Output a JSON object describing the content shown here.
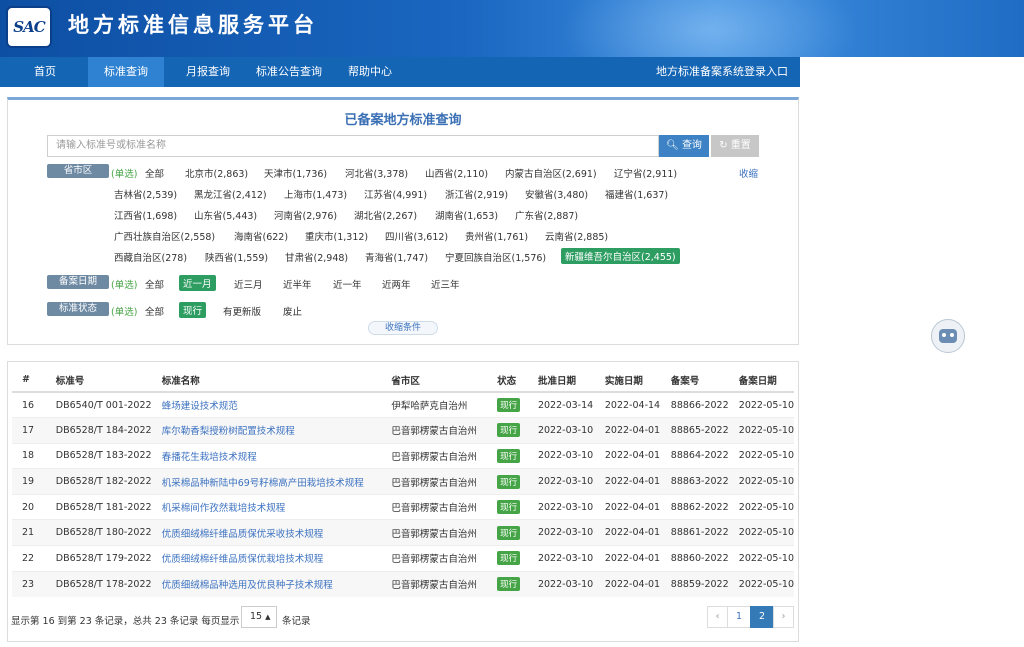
{
  "header": {
    "logo_text": "SAC",
    "title": "地方标准信息服务平台"
  },
  "nav": {
    "items": [
      "首页",
      "标准查询",
      "月报查询",
      "标准公告查询",
      "帮助中心"
    ],
    "active": "标准查询",
    "login": "地方标准备案系统登录入口"
  },
  "search": {
    "title": "已备案地方标准查询",
    "placeholder": "请输入标准号或标准名称",
    "search_btn": "查询",
    "reset_btn": "重置",
    "collapse": "收缩",
    "collapse_conditions": "收缩条件"
  },
  "filters": {
    "province_label": "省市区",
    "single": "(单选)",
    "all": "全部",
    "provinces": [
      "北京市(2,863)",
      "天津市(1,736)",
      "河北省(3,378)",
      "山西省(2,110)",
      "内蒙古自治区(2,691)",
      "辽宁省(2,911)",
      "吉林省(2,539)",
      "黑龙江省(2,412)",
      "上海市(1,473)",
      "江苏省(4,991)",
      "浙江省(2,919)",
      "安徽省(3,480)",
      "福建省(1,637)",
      "江西省(1,698)",
      "山东省(5,443)",
      "河南省(2,976)",
      "湖北省(2,267)",
      "湖南省(1,653)",
      "广东省(2,887)",
      "广西壮族自治区(2,558)",
      "海南省(622)",
      "重庆市(1,312)",
      "四川省(3,612)",
      "贵州省(1,761)",
      "云南省(2,885)",
      "西藏自治区(278)",
      "陕西省(1,559)",
      "甘肃省(2,948)",
      "青海省(1,747)",
      "宁夏回族自治区(1,576)",
      "新疆维吾尔自治区(2,455)"
    ],
    "date_label": "备案日期",
    "dates": [
      "近一月",
      "近三月",
      "近半年",
      "近一年",
      "近两年",
      "近三年"
    ],
    "status_label": "标准状态",
    "statuses": [
      "现行",
      "有更新版",
      "废止"
    ]
  },
  "table": {
    "headers": [
      "#",
      "标准号",
      "标准名称",
      "省市区",
      "状态",
      "批准日期",
      "实施日期",
      "备案号",
      "备案日期"
    ],
    "rows": [
      [
        "16",
        "DB6540/T 001-2022",
        "蜂场建设技术规范",
        "伊犁哈萨克自治州",
        "现行",
        "2022-03-14",
        "2022-04-14",
        "88866-2022",
        "2022-05-10"
      ],
      [
        "17",
        "DB6528/T 184-2022",
        "库尔勒香梨授粉树配置技术规程",
        "巴音郭楞蒙古自治州",
        "现行",
        "2022-03-10",
        "2022-04-01",
        "88865-2022",
        "2022-05-10"
      ],
      [
        "18",
        "DB6528/T 183-2022",
        "春播花生栽培技术规程",
        "巴音郭楞蒙古自治州",
        "现行",
        "2022-03-10",
        "2022-04-01",
        "88864-2022",
        "2022-05-10"
      ],
      [
        "19",
        "DB6528/T 182-2022",
        "机采棉品种新陆中69号籽棉高产田栽培技术规程",
        "巴音郭楞蒙古自治州",
        "现行",
        "2022-03-10",
        "2022-04-01",
        "88863-2022",
        "2022-05-10"
      ],
      [
        "20",
        "DB6528/T 181-2022",
        "机采棉间作孜然栽培技术规程",
        "巴音郭楞蒙古自治州",
        "现行",
        "2022-03-10",
        "2022-04-01",
        "88862-2022",
        "2022-05-10"
      ],
      [
        "21",
        "DB6528/T 180-2022",
        "优质细绒棉纤维品质保优采收技术规程",
        "巴音郭楞蒙古自治州",
        "现行",
        "2022-03-10",
        "2022-04-01",
        "88861-2022",
        "2022-05-10"
      ],
      [
        "22",
        "DB6528/T 179-2022",
        "优质细绒棉纤维品质保优栽培技术规程",
        "巴音郭楞蒙古自治州",
        "现行",
        "2022-03-10",
        "2022-04-01",
        "88860-2022",
        "2022-05-10"
      ],
      [
        "23",
        "DB6528/T 178-2022",
        "优质细绒棉品种选用及优良种子技术规程",
        "巴音郭楞蒙古自治州",
        "现行",
        "2022-03-10",
        "2022-04-01",
        "88859-2022",
        "2022-05-10"
      ]
    ]
  },
  "pagination": {
    "info": "显示第 16 到第 23 条记录，总共 23 条记录 每页显示",
    "per_page": "15",
    "per_unit": "条记录",
    "prev": "‹",
    "pages": [
      "1",
      "2"
    ],
    "active": "2",
    "next": "›"
  }
}
